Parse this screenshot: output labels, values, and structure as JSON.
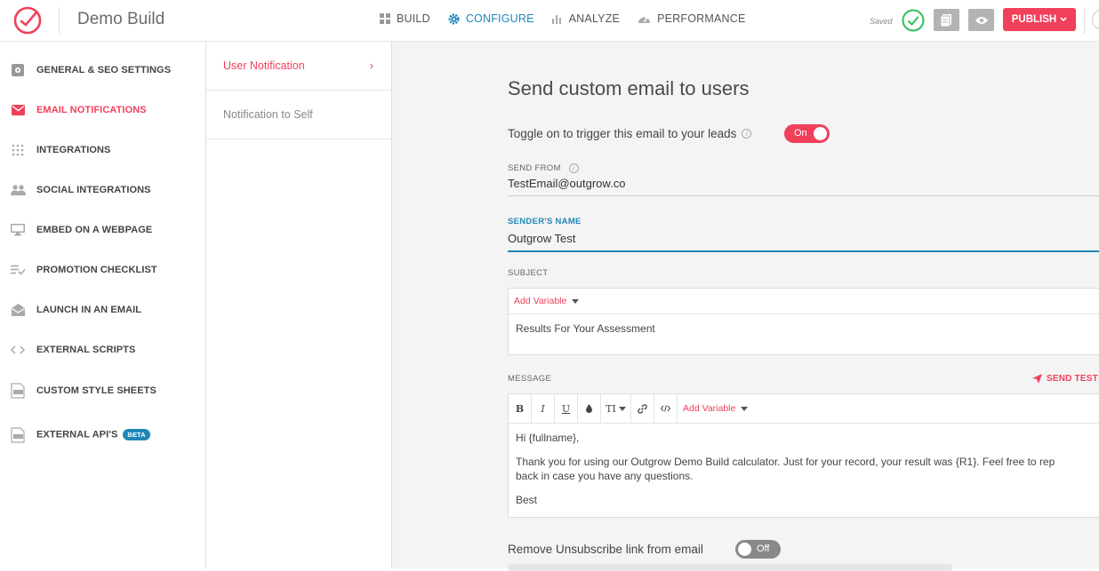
{
  "app": {
    "title": "Demo Build",
    "logo": "outgrow-logo-icon",
    "brand_color": "#f0405a",
    "accent_color": "#1f87b8"
  },
  "nav": {
    "items": [
      {
        "label": "BUILD",
        "icon": "grid-icon",
        "active": false
      },
      {
        "label": "CONFIGURE",
        "icon": "gear-icon",
        "active": true
      },
      {
        "label": "ANALYZE",
        "icon": "bar-chart-icon",
        "active": false
      },
      {
        "label": "PERFORMANCE",
        "icon": "dashboard-icon",
        "active": false
      }
    ]
  },
  "status": {
    "saved_label": "Saved"
  },
  "actions": {
    "publish_label": "PUBLISH"
  },
  "sidebar": {
    "items": [
      {
        "label": "GENERAL & SEO SETTINGS",
        "icon": "settings-box-icon",
        "active": false
      },
      {
        "label": "EMAIL NOTIFICATIONS",
        "icon": "email-icon",
        "active": true
      },
      {
        "label": "INTEGRATIONS",
        "icon": "dots-grid-icon",
        "active": false
      },
      {
        "label": "SOCIAL INTEGRATIONS",
        "icon": "people-icon",
        "active": false
      },
      {
        "label": "EMBED ON A WEBPAGE",
        "icon": "monitor-icon",
        "active": false
      },
      {
        "label": "PROMOTION CHECKLIST",
        "icon": "checklist-icon",
        "active": false
      },
      {
        "label": "LAUNCH IN AN EMAIL",
        "icon": "open-envelope-icon",
        "active": false
      },
      {
        "label": "EXTERNAL SCRIPTS",
        "icon": "code-icon",
        "active": false
      },
      {
        "label": "CUSTOM STYLE SHEETS",
        "icon": "css-file-icon",
        "active": false
      },
      {
        "label": "EXTERNAL API'S",
        "icon": "api-file-icon",
        "active": false,
        "badge": "BETA"
      }
    ]
  },
  "subnav": {
    "items": [
      {
        "label": "User Notification",
        "active": true
      },
      {
        "label": "Notification to Self",
        "active": false
      }
    ]
  },
  "form": {
    "heading": "Send custom email to users",
    "trigger_label": "Toggle on to trigger this email to your leads",
    "trigger_state": "On",
    "send_from_label": "SEND FROM",
    "send_from_value": "TestEmail@outgrow.co",
    "sender_name_label": "SENDER'S NAME",
    "sender_name_value": "Outgrow Test",
    "subject_label": "SUBJECT",
    "add_variable_label": "Add Variable",
    "subject_value": "Results For Your Assessment",
    "message_label": "MESSAGE",
    "send_test_label": "SEND TEST",
    "editor_tools": [
      "B",
      "I",
      "U",
      "color",
      "TI",
      "link",
      "code"
    ],
    "message_lines": [
      "Hi {fullname},",
      "Thank you for using our Outgrow Demo Build calculator. Just for your record, your result was {R1}. Feel free to rep",
      "back in case you have any questions.",
      "Best"
    ],
    "unsubscribe_label": "Remove Unsubscribe link from email",
    "unsubscribe_state": "Off"
  }
}
